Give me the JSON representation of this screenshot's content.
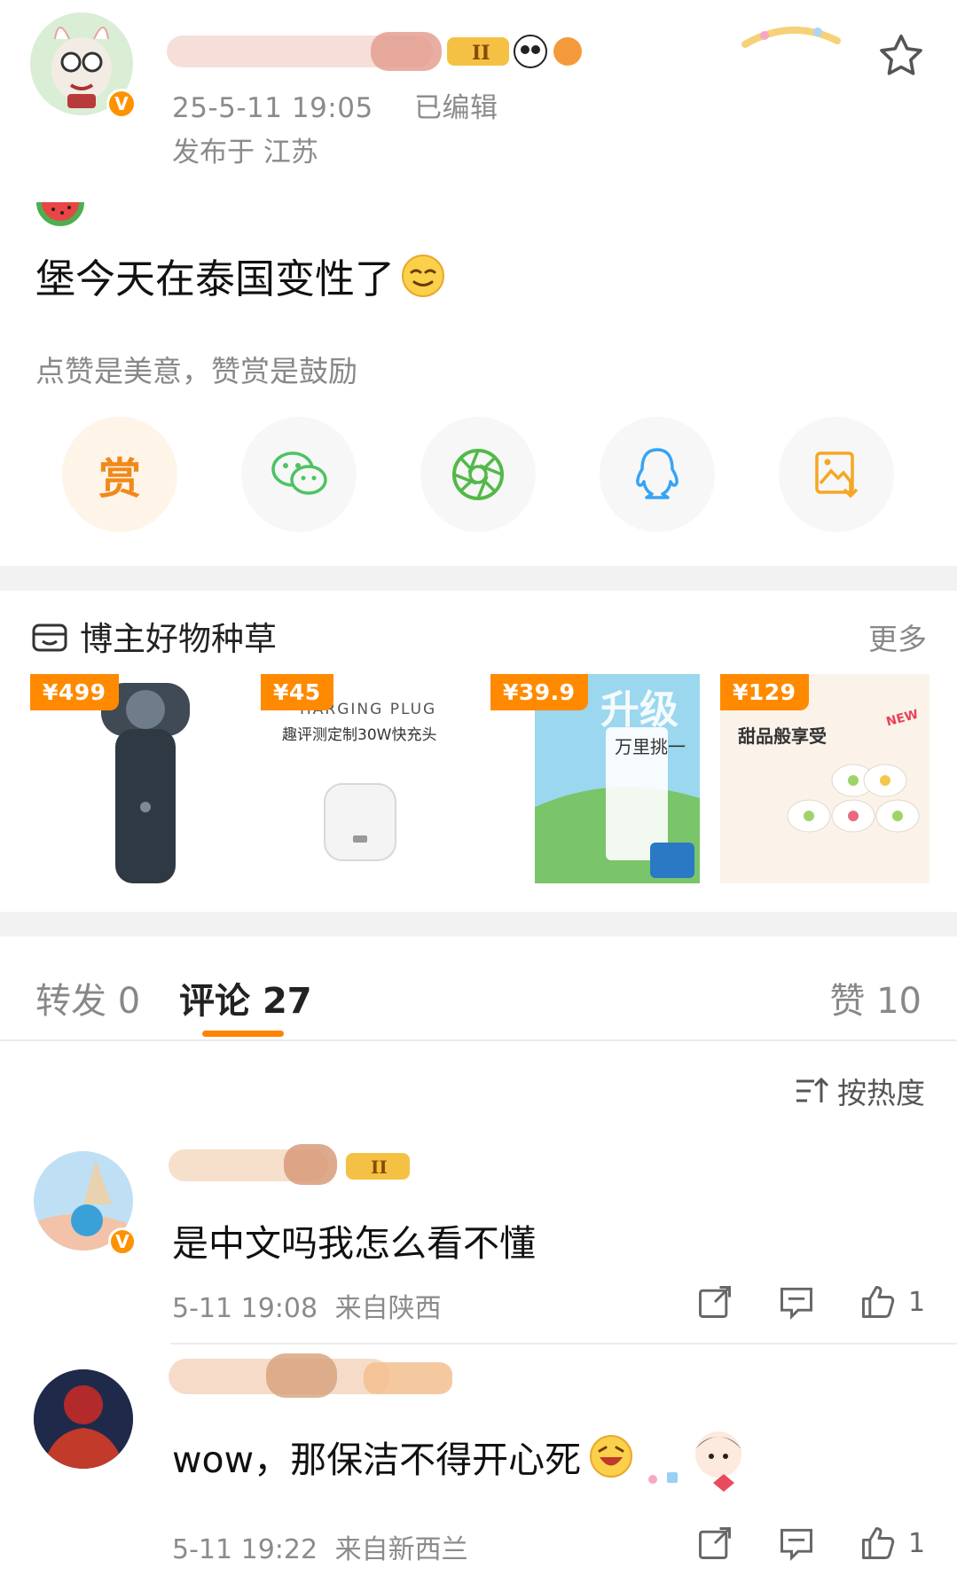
{
  "post": {
    "timestamp": "25-5-11 19:05",
    "edited": "已编辑",
    "location": "发布于 江苏",
    "text": "堡今天在泰国变性了",
    "reward_hint": "点赞是美意，赞赏是鼓励",
    "reward_label": "赏"
  },
  "products": {
    "title": "博主好物种草",
    "more": "更多",
    "items": [
      {
        "price": "¥499"
      },
      {
        "price": "¥45",
        "caption_en": "HARGING PLUG",
        "caption_cn": "趣评测定制30W快充头"
      },
      {
        "price": "¥39.9",
        "caption_cn": "万里挑一",
        "banner": "升级"
      },
      {
        "price": "¥129",
        "caption_cn": "甜品般享受",
        "tag": "NEW"
      }
    ]
  },
  "tabs": {
    "repost_label": "转发",
    "repost_count": "0",
    "comment_label": "评论",
    "comment_count": "27",
    "like_label": "赞",
    "like_count": "10"
  },
  "sort": {
    "label": "按热度"
  },
  "comments": [
    {
      "text": "是中文吗我怎么看不懂",
      "time": "5-11 19:08",
      "from": "来自陕西",
      "likes": "1"
    },
    {
      "text": "wow，那保洁不得开心死",
      "time": "5-11 19:22",
      "from": "来自新西兰",
      "likes": "1"
    }
  ],
  "colors": {
    "accent": "#ff8200",
    "meta": "#8b8b8b",
    "wechat": "#4cc364",
    "moments": "#52b948",
    "qq": "#38a3f5",
    "save": "#f5a623"
  }
}
